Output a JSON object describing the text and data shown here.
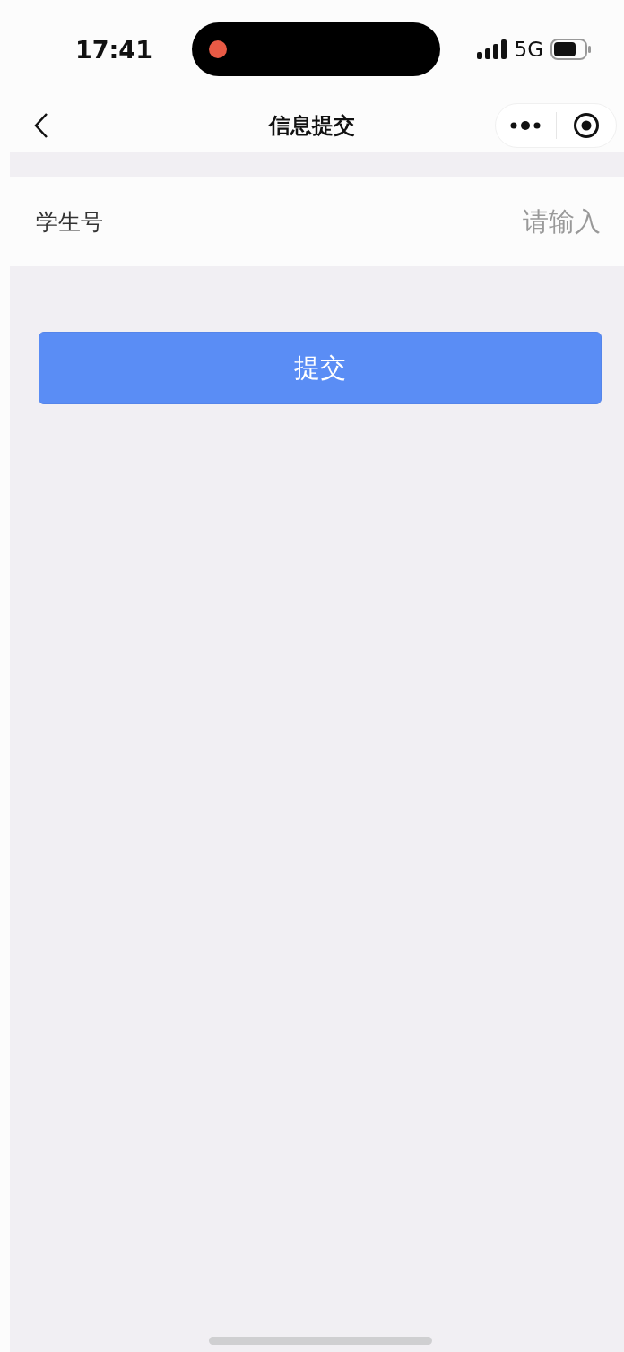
{
  "status_bar": {
    "time": "17:41",
    "network": "5G"
  },
  "nav_bar": {
    "title": "信息提交"
  },
  "form": {
    "fields": [
      {
        "label": "学生号",
        "placeholder": "请输入"
      }
    ]
  },
  "submit_button": {
    "label": "提交"
  }
}
